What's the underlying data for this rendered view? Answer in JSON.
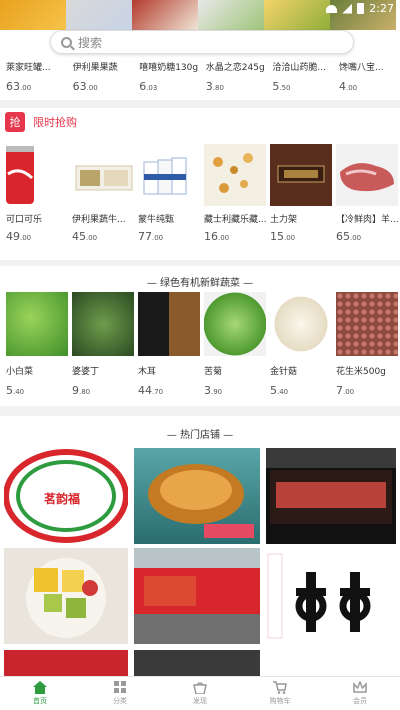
{
  "status_bar": {
    "time": "2:27"
  },
  "search": {
    "placeholder": "搜索"
  },
  "top_products": [
    {
      "name": "萊家旺罐...",
      "price": "63",
      "cents": ".00"
    },
    {
      "name": "伊利果果蔬",
      "price": "63",
      "cents": ".00"
    },
    {
      "name": "嘻嘻奶糖130g",
      "price": "6",
      "cents": ".03"
    },
    {
      "name": "水晶之恋245g",
      "price": "3",
      "cents": ".80"
    },
    {
      "name": "洽洽山药脆...",
      "price": "5",
      "cents": ".50"
    },
    {
      "name": "馋嘴八宝...",
      "price": "4",
      "cents": ".00"
    }
  ],
  "flash_sale": {
    "icon_text": "抢",
    "title": "限时抢购",
    "items": [
      {
        "name": "可口可乐",
        "price": "49",
        "cents": ".00"
      },
      {
        "name": "伊利果蔬牛...",
        "price": "45",
        "cents": ".00"
      },
      {
        "name": "蒙牛纯甄",
        "price": "77",
        "cents": ".00"
      },
      {
        "name": "藏士利藏乐藏...",
        "price": "16",
        "cents": ".00"
      },
      {
        "name": "土力架",
        "price": "15",
        "cents": ".00"
      },
      {
        "name": "【冷鲜肉】羊...",
        "price": "65",
        "cents": ".00"
      }
    ]
  },
  "vegetables": {
    "title": "— 绿色有机新鲜蔬菜 —",
    "items": [
      {
        "name": "小白菜",
        "price": "5",
        "cents": ".40"
      },
      {
        "name": "婆婆丁",
        "price": "9",
        "cents": ".80"
      },
      {
        "name": "木耳",
        "price": "44",
        "cents": ".70"
      },
      {
        "name": "苦菊",
        "price": "3",
        "cents": ".90"
      },
      {
        "name": "金针菇",
        "price": "5",
        "cents": ".40"
      },
      {
        "name": "花生米500g",
        "price": "7",
        "cents": ".00"
      }
    ]
  },
  "shops": {
    "title": "— 热门店铺 —",
    "logo_text": "茗韵福"
  },
  "tabbar": [
    {
      "label": "首页",
      "active": true
    },
    {
      "label": "分类",
      "active": false
    },
    {
      "label": "发现",
      "active": false
    },
    {
      "label": "购物车",
      "active": false
    },
    {
      "label": "会员",
      "active": false
    }
  ]
}
